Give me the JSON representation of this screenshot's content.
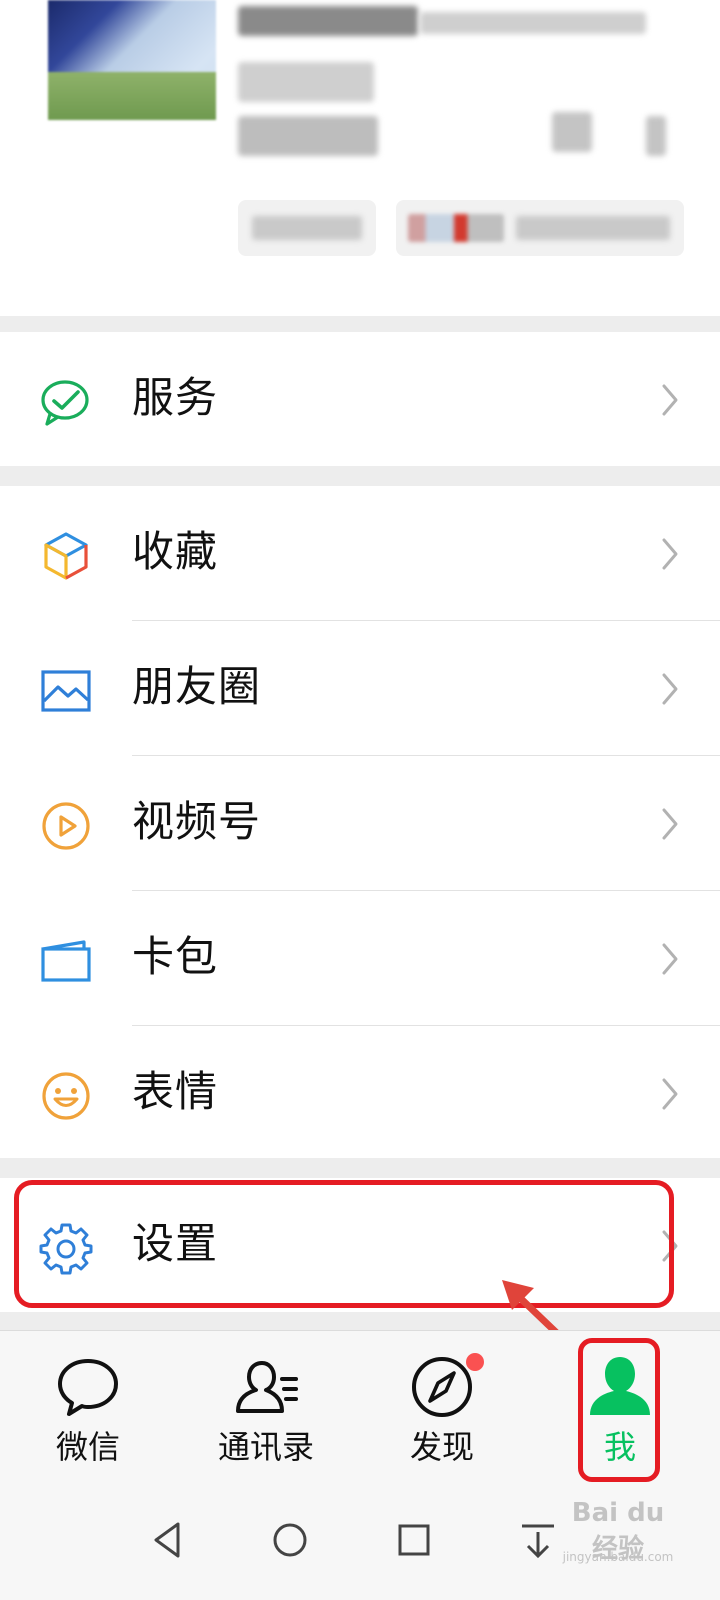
{
  "menu": {
    "services": {
      "label": "服务",
      "icon": "services-check-icon"
    },
    "group2": [
      {
        "label": "收藏",
        "icon": "favorites-cube-icon"
      },
      {
        "label": "朋友圈",
        "icon": "moments-picture-icon"
      },
      {
        "label": "视频号",
        "icon": "channels-play-icon"
      },
      {
        "label": "卡包",
        "icon": "card-wallet-icon"
      },
      {
        "label": "表情",
        "icon": "sticker-smile-icon"
      }
    ],
    "settings": {
      "label": "设置",
      "icon": "settings-gear-icon"
    }
  },
  "tabs": [
    {
      "label": "微信",
      "icon": "chat-bubble-icon",
      "active": false
    },
    {
      "label": "通讯录",
      "icon": "contacts-icon",
      "active": false
    },
    {
      "label": "发现",
      "icon": "discover-compass-icon",
      "active": false,
      "badge": true
    },
    {
      "label": "我",
      "icon": "me-person-icon",
      "active": true
    }
  ],
  "system_nav": [
    "back-icon",
    "home-icon",
    "recents-icon",
    "download-icon"
  ],
  "watermark": {
    "brand": "Bai du 经验",
    "url": "jingyan.baidu.com"
  },
  "colors": {
    "accent_green": "#07c160",
    "annotation_red": "#e51c23",
    "badge_red": "#fa5151",
    "background": "#ededed"
  }
}
